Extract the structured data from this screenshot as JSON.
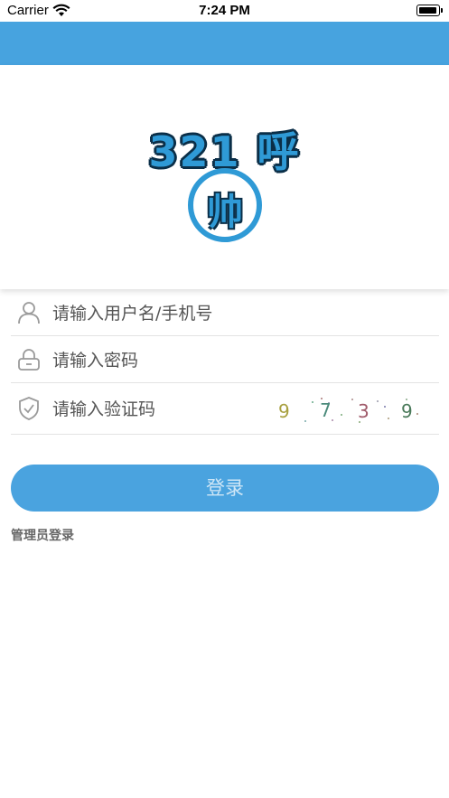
{
  "status_bar": {
    "carrier": "Carrier",
    "time": "7:24 PM"
  },
  "logo": {
    "title": "321 呼",
    "circle_char": "帅",
    "color": "#2f9ad6"
  },
  "form": {
    "username": {
      "placeholder": "请输入用户名/手机号",
      "icon": "user-icon"
    },
    "password": {
      "placeholder": "请输入密码",
      "icon": "lock-icon"
    },
    "captcha": {
      "placeholder": "请输入验证码",
      "icon": "shield-icon",
      "code": [
        "9",
        "7",
        "3",
        "9"
      ]
    }
  },
  "actions": {
    "login_label": "登录",
    "admin_login_label": "管理员登录"
  },
  "colors": {
    "accent": "#47a3df",
    "button": "#4aa3df"
  }
}
